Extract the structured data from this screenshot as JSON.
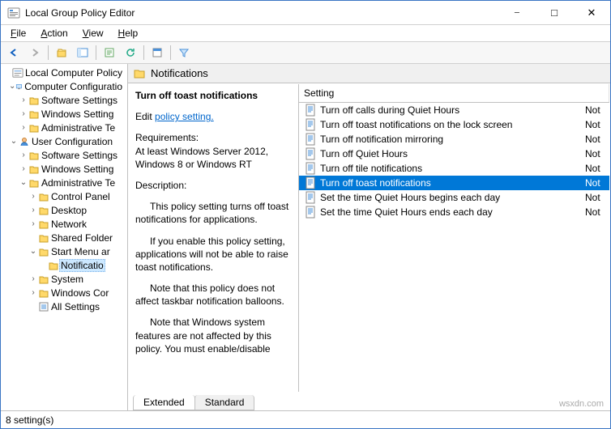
{
  "window": {
    "title": "Local Group Policy Editor"
  },
  "menu": {
    "file": "File",
    "action": "Action",
    "view": "View",
    "help": "Help"
  },
  "tree": {
    "root": "Local Computer Policy",
    "cc": "Computer Configuratio",
    "cc_ss": "Software Settings",
    "cc_ws": "Windows Setting",
    "cc_at": "Administrative Te",
    "uc": "User Configuration",
    "uc_ss": "Software Settings",
    "uc_ws": "Windows Setting",
    "uc_at": "Administrative Te",
    "cp": "Control Panel",
    "desktop": "Desktop",
    "network": "Network",
    "shared": "Shared Folder",
    "start": "Start Menu ar",
    "notif": "Notificatio",
    "system": "System",
    "wincomp": "Windows Cor",
    "allset": "All Settings"
  },
  "header": {
    "title": "Notifications"
  },
  "desc": {
    "setting_title": "Turn off toast notifications",
    "edit_label": "Edit",
    "edit_link": "policy setting.",
    "req_label": "Requirements:",
    "req_text": "At least Windows Server 2012, Windows 8 or Windows RT",
    "desc_label": "Description:",
    "p1": "This policy setting turns off toast notifications for applications.",
    "p2": "If you enable this policy setting, applications will not be able to raise toast notifications.",
    "p3": "Note that this policy does not affect taskbar notification balloons.",
    "p4": "Note that Windows system features are not affected by this policy.  You must enable/disable"
  },
  "list": {
    "col_setting": "Setting",
    "items": [
      {
        "name": "Turn off calls during Quiet Hours",
        "state": "Not"
      },
      {
        "name": "Turn off toast notifications on the lock screen",
        "state": "Not"
      },
      {
        "name": "Turn off notification mirroring",
        "state": "Not"
      },
      {
        "name": "Turn off Quiet Hours",
        "state": "Not"
      },
      {
        "name": "Turn off tile notifications",
        "state": "Not"
      },
      {
        "name": "Turn off toast notifications",
        "state": "Not"
      },
      {
        "name": "Set the time Quiet Hours begins each day",
        "state": "Not"
      },
      {
        "name": "Set the time Quiet Hours ends each day",
        "state": "Not"
      }
    ]
  },
  "tabs": {
    "extended": "Extended",
    "standard": "Standard"
  },
  "status": {
    "text": "8 setting(s)"
  },
  "watermark": "wsxdn.com"
}
